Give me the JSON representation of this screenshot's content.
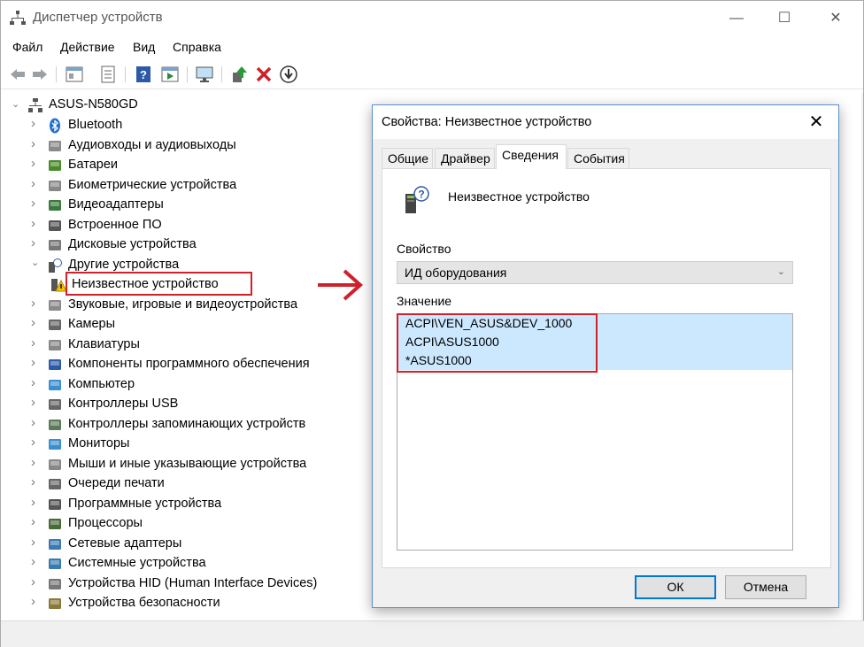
{
  "window": {
    "title": "Диспетчер устройств",
    "minimize_glyph": "—",
    "maximize_glyph": "☐",
    "close_glyph": "✕"
  },
  "menu": [
    "Файл",
    "Действие",
    "Вид",
    "Справка"
  ],
  "toolbar_icons": [
    "back-arrow-icon",
    "forward-arrow-icon",
    "properties-pane-icon",
    "device-list-icon",
    "help-icon",
    "run-icon",
    "monitor-scan-icon",
    "update-driver-icon",
    "uninstall-x-icon",
    "download-icon"
  ],
  "tree": {
    "root": "ASUS-N580GD",
    "items": [
      {
        "label": "Bluetooth",
        "icon": "bluetooth-icon"
      },
      {
        "label": "Аудиовходы и аудиовыходы",
        "icon": "speaker-icon"
      },
      {
        "label": "Батареи",
        "icon": "battery-icon"
      },
      {
        "label": "Биометрические устройства",
        "icon": "fingerprint-icon"
      },
      {
        "label": "Видеоадаптеры",
        "icon": "display-adapter-icon"
      },
      {
        "label": "Встроенное ПО",
        "icon": "firmware-icon"
      },
      {
        "label": "Дисковые устройства",
        "icon": "disk-icon"
      },
      {
        "label": "Другие устройства",
        "icon": "unknown-device-icon",
        "expanded": true
      },
      {
        "label": "Неизвестное устройство",
        "icon": "warning-device-icon",
        "child": true
      },
      {
        "label": "Звуковые, игровые и видеоустройства",
        "icon": "speaker-icon"
      },
      {
        "label": "Камеры",
        "icon": "camera-icon"
      },
      {
        "label": "Клавиатуры",
        "icon": "keyboard-icon"
      },
      {
        "label": "Компоненты программного обеспечения",
        "icon": "software-component-icon"
      },
      {
        "label": "Компьютер",
        "icon": "computer-icon"
      },
      {
        "label": "Контроллеры USB",
        "icon": "usb-icon"
      },
      {
        "label": "Контроллеры запоминающих устройств",
        "icon": "storage-controller-icon"
      },
      {
        "label": "Мониторы",
        "icon": "monitor-icon"
      },
      {
        "label": "Мыши и иные указывающие устройства",
        "icon": "mouse-icon"
      },
      {
        "label": "Очереди печати",
        "icon": "printer-icon"
      },
      {
        "label": "Программные устройства",
        "icon": "software-device-icon"
      },
      {
        "label": "Процессоры",
        "icon": "processor-icon"
      },
      {
        "label": "Сетевые адаптеры",
        "icon": "network-adapter-icon"
      },
      {
        "label": "Системные устройства",
        "icon": "system-device-icon"
      },
      {
        "label": "Устройства HID (Human Interface Devices)",
        "icon": "hid-icon"
      },
      {
        "label": "Устройства безопасности",
        "icon": "security-device-icon"
      }
    ]
  },
  "dialog": {
    "title": "Свойства: Неизвестное устройство",
    "close_glyph": "✕",
    "tabs": [
      "Общие",
      "Драйвер",
      "Сведения",
      "События"
    ],
    "active_tab": "Сведения",
    "device_name": "Неизвестное устройство",
    "property_label": "Свойство",
    "property_value": "ИД оборудования",
    "value_label": "Значение",
    "values": [
      "ACPI\\VEN_ASUS&DEV_1000",
      "ACPI\\ASUS1000",
      "*ASUS1000"
    ],
    "ok_label": "ОК",
    "cancel_label": "Отмена"
  },
  "colors": {
    "highlight_red": "#d0202a",
    "selection_blue": "#cce8ff",
    "ok_border": "#0078d7"
  }
}
